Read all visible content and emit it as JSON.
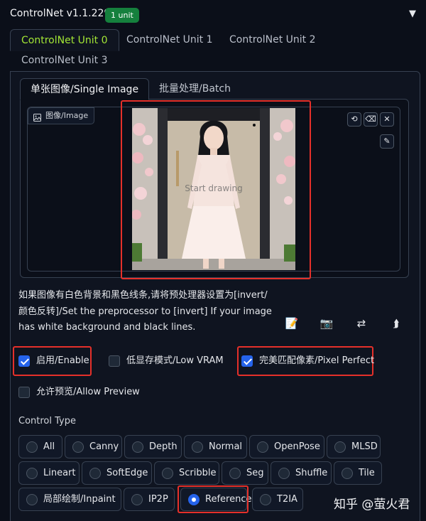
{
  "header": {
    "title": "ControlNet v1.1.229",
    "badge": "1 unit",
    "collapse_icon": "▼"
  },
  "unit_tabs": [
    {
      "label": "ControlNet Unit 0",
      "active": true
    },
    {
      "label": "ControlNet Unit 1",
      "active": false
    },
    {
      "label": "ControlNet Unit 2",
      "active": false
    },
    {
      "label": "ControlNet Unit 3",
      "active": false
    }
  ],
  "image_tabs": [
    {
      "label": "单张图像/Single Image",
      "active": true
    },
    {
      "label": "批量处理/Batch",
      "active": false
    }
  ],
  "image_input": {
    "label": "图像/Image",
    "canvas_hint": "Start drawing",
    "buttons": {
      "undo": "⟲",
      "clear": "⌫",
      "close": "✕",
      "brush": "✎"
    }
  },
  "note": "如果图像有白色背景和黑色线条,请将预处理器设置为[invert/颜色反转]/Set the preprocessor to [invert] If your image has white background and black lines.",
  "tools": {
    "edit": "📝",
    "camera": "📷",
    "swap": "⇄",
    "upload": "⮭"
  },
  "checkboxes": {
    "enable": {
      "label": "启用/Enable",
      "checked": true
    },
    "low_vram": {
      "label": "低显存模式/Low VRAM",
      "checked": false
    },
    "pixel_perfect": {
      "label": "完美匹配像素/Pixel Perfect",
      "checked": true
    },
    "allow_preview": {
      "label": "允许预览/Allow Preview",
      "checked": false
    }
  },
  "control_type": {
    "label": "Control Type",
    "options": [
      "All",
      "Canny",
      "Depth",
      "Normal",
      "OpenPose",
      "MLSD",
      "Lineart",
      "SoftEdge",
      "Scribble",
      "Seg",
      "Shuffle",
      "Tile",
      "局部绘制/Inpaint",
      "IP2P",
      "Reference",
      "T2IA"
    ],
    "selected": "Reference"
  },
  "watermark": "知乎 @萤火君",
  "colors": {
    "accent_green": "#a3e635",
    "badge_green": "#15803d",
    "highlight_red": "#e5302a",
    "check_blue": "#2563eb",
    "background": "#0b0f19"
  }
}
